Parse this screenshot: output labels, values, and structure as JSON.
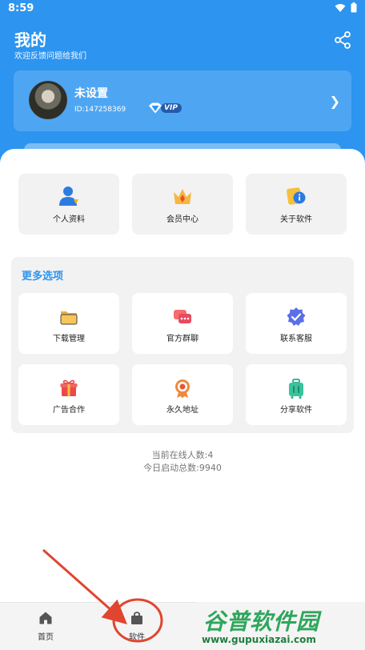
{
  "status_bar": {
    "time": "8:59"
  },
  "header": {
    "title": "我的",
    "subtitle": "欢迎反馈问题给我们"
  },
  "profile": {
    "name": "未设置",
    "id": "ID:147258369",
    "vip_label": "VIP"
  },
  "top_items": [
    {
      "label": "个人资料",
      "icon": "person-icon"
    },
    {
      "label": "会员中心",
      "icon": "crown-icon"
    },
    {
      "label": "关于软件",
      "icon": "info-icon"
    }
  ],
  "more_options": {
    "title": "更多选项",
    "items": [
      {
        "label": "下载管理",
        "icon": "folder-icon"
      },
      {
        "label": "官方群聊",
        "icon": "chat-icon"
      },
      {
        "label": "联系客服",
        "icon": "verified-badge-icon"
      },
      {
        "label": "广告合作",
        "icon": "gift-icon"
      },
      {
        "label": "永久地址",
        "icon": "target-icon"
      },
      {
        "label": "分享软件",
        "icon": "luggage-icon"
      }
    ]
  },
  "stats": {
    "online": "当前在线人数:4",
    "today": "今日启动总数:9940"
  },
  "bottom_nav": [
    {
      "label": "首页",
      "icon": "home-icon"
    },
    {
      "label": "软件",
      "icon": "bag-icon"
    }
  ],
  "watermark": {
    "title": "谷普软件园",
    "url": "www.gupuxiazai.com"
  },
  "colors": {
    "primary": "#2d94ef",
    "tile_bg": "#f2f2f2",
    "annotation": "#e0452f"
  }
}
